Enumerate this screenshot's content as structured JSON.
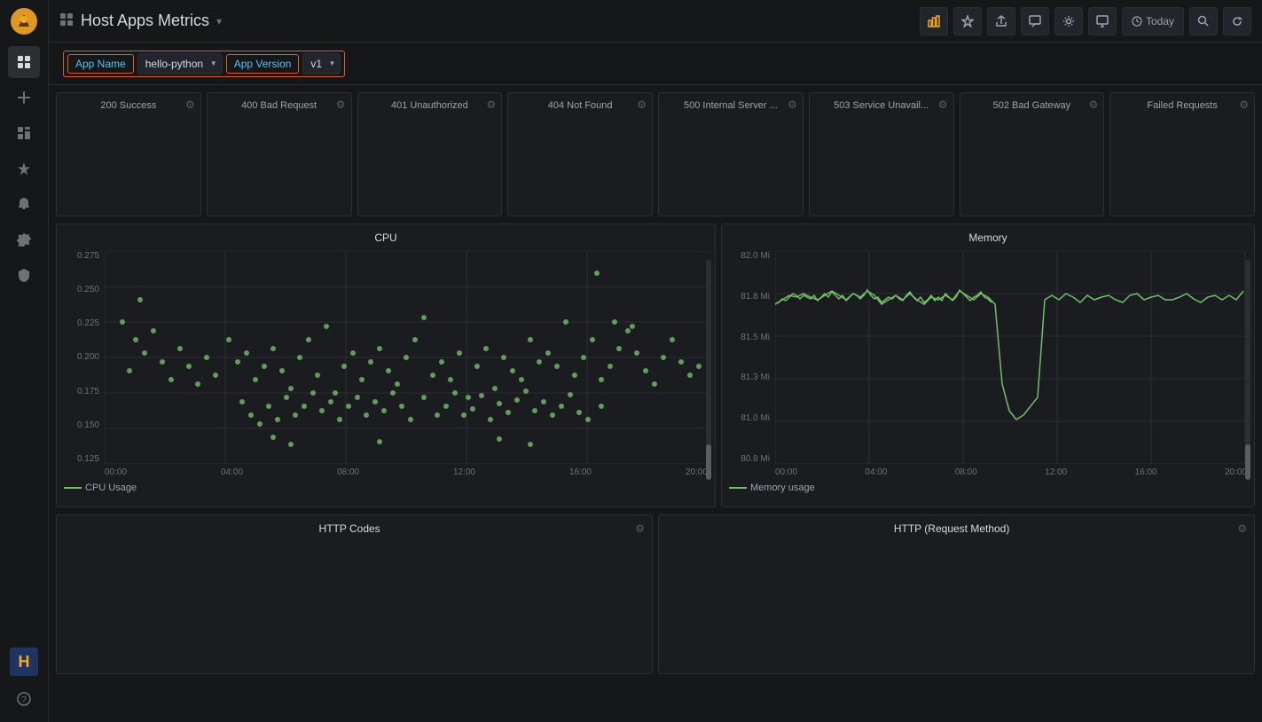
{
  "app": {
    "title": "Host Apps Metrics",
    "logo_icon": "🔥"
  },
  "sidebar": {
    "icons": [
      {
        "name": "grid-icon",
        "symbol": "⊞",
        "active": false
      },
      {
        "name": "plus-icon",
        "symbol": "+",
        "active": false
      },
      {
        "name": "dashboard-icon",
        "symbol": "▦",
        "active": false
      },
      {
        "name": "star-icon",
        "symbol": "✦",
        "active": false
      },
      {
        "name": "bell-icon",
        "symbol": "🔔",
        "active": false
      },
      {
        "name": "gear-icon",
        "symbol": "⚙",
        "active": false
      },
      {
        "name": "shield-icon",
        "symbol": "🛡",
        "active": false
      }
    ],
    "bottom_icons": [
      {
        "name": "help-icon",
        "symbol": "?"
      }
    ],
    "avatar_label": "H"
  },
  "topbar": {
    "title": "Host Apps Metrics",
    "chevron": "▾",
    "buttons": [
      {
        "name": "chart-btn",
        "symbol": "📊"
      },
      {
        "name": "star-btn",
        "symbol": "☆"
      },
      {
        "name": "share-btn",
        "symbol": "↑"
      },
      {
        "name": "comment-btn",
        "symbol": "💬"
      },
      {
        "name": "settings-btn",
        "symbol": "⚙"
      },
      {
        "name": "monitor-btn",
        "symbol": "🖥"
      },
      {
        "name": "today-btn",
        "label": "Today",
        "symbol": "🕐"
      },
      {
        "name": "search-btn",
        "symbol": "🔍"
      },
      {
        "name": "refresh-btn",
        "symbol": "↻"
      }
    ]
  },
  "filters": {
    "app_name_label": "App Name",
    "app_name_value": "hello-python",
    "app_version_label": "App Version",
    "app_version_value": "v1"
  },
  "metric_cards": [
    {
      "title": "200 Success"
    },
    {
      "title": "400 Bad Request"
    },
    {
      "title": "401 Unauthorized"
    },
    {
      "title": "404 Not Found"
    },
    {
      "title": "500 Internal Server ..."
    },
    {
      "title": "503 Service Unavail..."
    },
    {
      "title": "502 Bad Gateway"
    },
    {
      "title": "Failed Requests"
    }
  ],
  "cpu_chart": {
    "title": "CPU",
    "legend_label": "CPU Usage",
    "y_labels": [
      "0.275",
      "0.250",
      "0.225",
      "0.200",
      "0.175",
      "0.150",
      "0.125"
    ],
    "x_labels": [
      "00:00",
      "04:00",
      "08:00",
      "12:00",
      "16:00",
      "20:00"
    ]
  },
  "memory_chart": {
    "title": "Memory",
    "legend_label": "Memory usage",
    "y_labels": [
      "82.0 Mi",
      "81.8 Mi",
      "81.5 Mi",
      "81.3 Mi",
      "81.0 Mi",
      "80.8 Mi"
    ],
    "x_labels": [
      "00:00",
      "04:00",
      "08:00",
      "12:00",
      "16:00",
      "20:00"
    ]
  },
  "http_codes_chart": {
    "title": "HTTP Codes"
  },
  "http_method_chart": {
    "title": "HTTP (Request Method)"
  }
}
